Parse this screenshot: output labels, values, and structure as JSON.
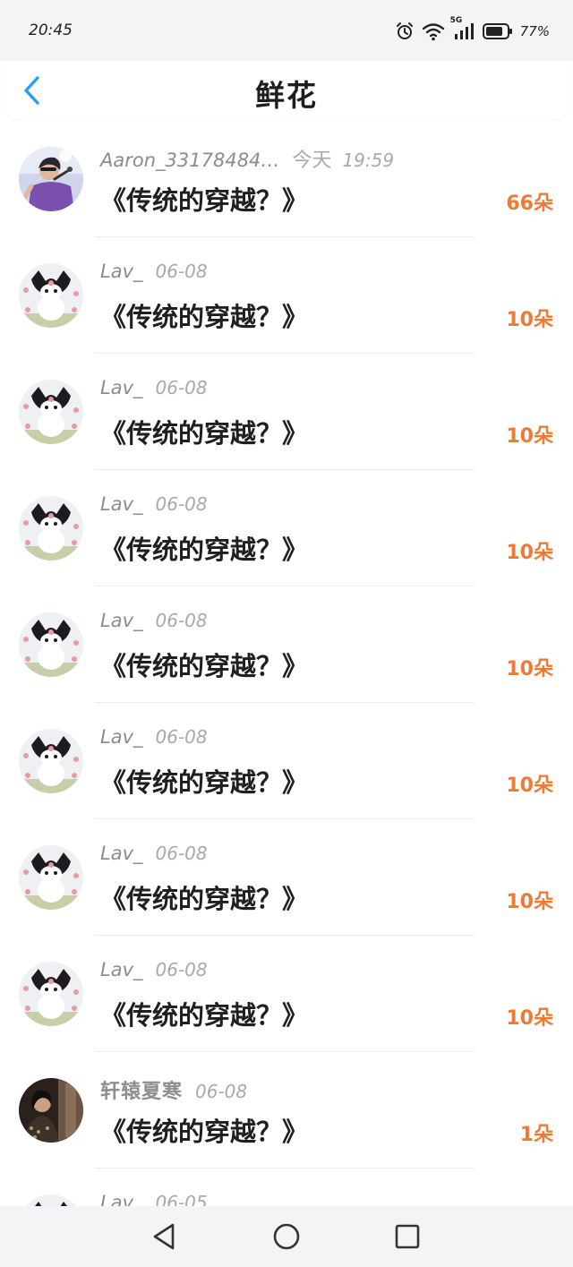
{
  "status_bar": {
    "time": "20:45",
    "network": "5G",
    "battery": "77%",
    "icons": [
      "alarm-icon",
      "wifi-icon",
      "signal-icon",
      "battery-icon"
    ]
  },
  "header": {
    "title": "鲜花",
    "back_icon": "chevron-left-icon"
  },
  "colors": {
    "accent_blue": "#2a9df4",
    "count_orange": "#ee7a35"
  },
  "items": [
    {
      "avatar": "photo-avatar-singer",
      "name": "Aaron_33178484…",
      "date_prefix": "今天",
      "date": "19:59",
      "title": "《传统的穿越？》",
      "count": "66朵"
    },
    {
      "avatar": "kuromi-avatar",
      "name": "Lav_",
      "date_prefix": "",
      "date": "06-08",
      "title": "《传统的穿越？》",
      "count": "10朵"
    },
    {
      "avatar": "kuromi-avatar",
      "name": "Lav_",
      "date_prefix": "",
      "date": "06-08",
      "title": "《传统的穿越？》",
      "count": "10朵"
    },
    {
      "avatar": "kuromi-avatar",
      "name": "Lav_",
      "date_prefix": "",
      "date": "06-08",
      "title": "《传统的穿越？》",
      "count": "10朵"
    },
    {
      "avatar": "kuromi-avatar",
      "name": "Lav_",
      "date_prefix": "",
      "date": "06-08",
      "title": "《传统的穿越？》",
      "count": "10朵"
    },
    {
      "avatar": "kuromi-avatar",
      "name": "Lav_",
      "date_prefix": "",
      "date": "06-08",
      "title": "《传统的穿越？》",
      "count": "10朵"
    },
    {
      "avatar": "kuromi-avatar",
      "name": "Lav_",
      "date_prefix": "",
      "date": "06-08",
      "title": "《传统的穿越？》",
      "count": "10朵"
    },
    {
      "avatar": "kuromi-avatar",
      "name": "Lav_",
      "date_prefix": "",
      "date": "06-08",
      "title": "《传统的穿越？》",
      "count": "10朵"
    },
    {
      "avatar": "photo-avatar-woman",
      "name": "轩辕夏寒",
      "date_prefix": "",
      "date": "06-08",
      "title": "《传统的穿越？》",
      "count": "1朵"
    },
    {
      "avatar": "kuromi-avatar",
      "name": "Lav_",
      "date_prefix": "",
      "date": "06-05",
      "title": "",
      "count": ""
    }
  ],
  "nav_bar": {
    "buttons": [
      "back-triangle-icon",
      "home-circle-icon",
      "recent-square-icon"
    ]
  }
}
